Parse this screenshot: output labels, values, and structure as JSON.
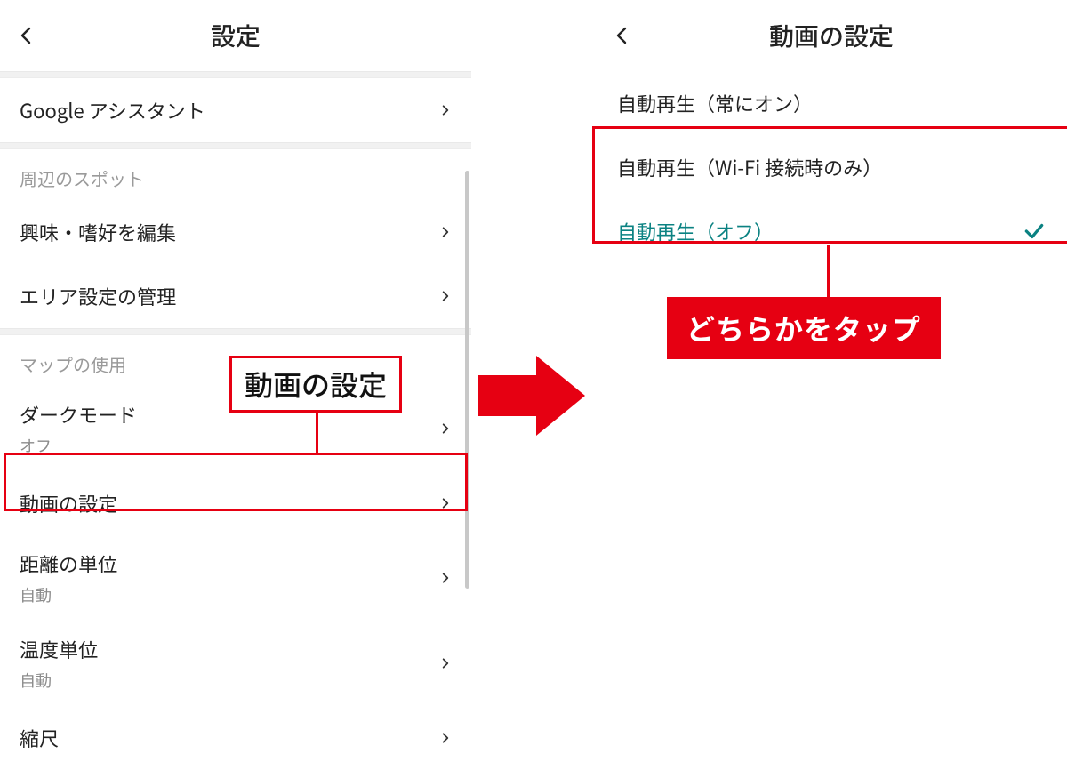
{
  "left": {
    "title": "設定",
    "top_row": {
      "label": "Google アシスタント"
    },
    "section1": {
      "header": "周辺のスポット",
      "rows": [
        {
          "label": "興味・嗜好を編集"
        },
        {
          "label": "エリア設定の管理"
        }
      ]
    },
    "section2": {
      "header": "マップの使用",
      "rows": [
        {
          "label": "ダークモード",
          "sub": "オフ"
        },
        {
          "label": "動画の設定"
        },
        {
          "label": "距離の単位",
          "sub": "自動"
        },
        {
          "label": "温度単位",
          "sub": "自動"
        },
        {
          "label": "縮尺"
        }
      ]
    },
    "callout": "動画の設定"
  },
  "right": {
    "title": "動画の設定",
    "options": [
      {
        "label": "自動再生（常にオン）",
        "selected": false
      },
      {
        "label": "自動再生（Wi-Fi 接続時のみ）",
        "selected": false
      },
      {
        "label": "自動再生（オフ）",
        "selected": true
      }
    ],
    "tap_label": "どちらかをタップ"
  },
  "colors": {
    "annotation_red": "#e60012",
    "teal_selected": "#0b8282"
  }
}
